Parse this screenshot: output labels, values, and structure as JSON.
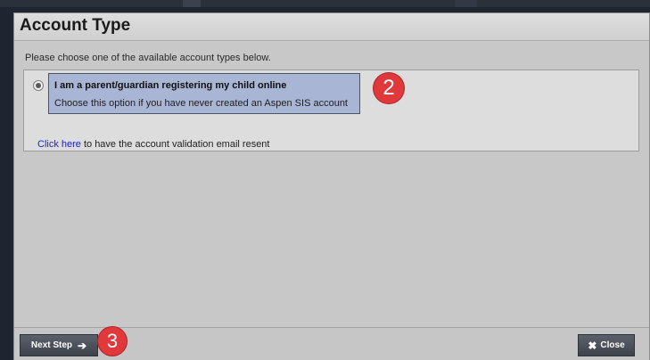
{
  "dialog": {
    "title": "Account Type",
    "instructions": "Please choose one of the available account types below.",
    "option": {
      "title": "I am a parent/guardian registering my child online",
      "description": "Choose this option if you have never created an Aspen SIS account",
      "selected": true
    },
    "resend": {
      "link_text": "Click here",
      "rest_text": " to have the account validation email resent"
    },
    "callouts": {
      "step2": "2",
      "step3": "3"
    },
    "footer": {
      "next_label": "Next Step",
      "next_icon": "arrow-right-icon",
      "close_label": "Close",
      "close_icon": "close-x-icon"
    }
  }
}
